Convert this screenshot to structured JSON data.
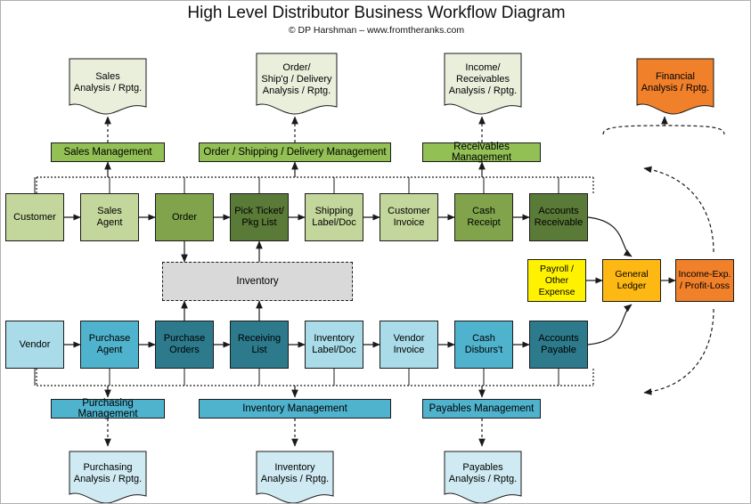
{
  "header": {
    "title": "High Level Distributor Business Workflow Diagram",
    "subtitle": "© DP Harshman – www.fromtheranks.com"
  },
  "colors": {
    "green_light": "#C3D69B",
    "green_mid": "#80A34C",
    "green_dark": "#5A7A37",
    "green_mgmt": "#92C055",
    "blue_light": "#A9DCE8",
    "blue_mid": "#4FB3CE",
    "blue_dark": "#2C7A8C",
    "blue_mgmt": "#4FB3CE",
    "report_green": "#EAEFDC",
    "report_blue": "#CFEAF2",
    "yellow": "#FFF200",
    "amber": "#FDB813",
    "orange": "#F0802A",
    "gray": "#D9D9D9",
    "stroke": "#1A1A1A"
  },
  "top_reports": [
    {
      "label": "Sales\nAnalysis / Rptg.",
      "fill": "report_green"
    },
    {
      "label": "Order/\nShip'g / Delivery\nAnalysis / Rptg.",
      "fill": "report_green"
    },
    {
      "label": "Income/\nReceivables\nAnalysis / Rptg.",
      "fill": "report_green"
    },
    {
      "label": "Financial\nAnalysis / Rptg.",
      "fill": "orange"
    }
  ],
  "top_management": [
    {
      "label": "Sales Management"
    },
    {
      "label": "Order / Shipping / Delivery Management"
    },
    {
      "label": "Receivables Management"
    }
  ],
  "sales_row": [
    {
      "label": "Customer",
      "fill": "green_light"
    },
    {
      "label": "Sales\nAgent",
      "fill": "green_light"
    },
    {
      "label": "Order",
      "fill": "green_mid"
    },
    {
      "label": "Pick Ticket/\nPkg List",
      "fill": "green_dark"
    },
    {
      "label": "Shipping\nLabel/Doc",
      "fill": "green_light"
    },
    {
      "label": "Customer\nInvoice",
      "fill": "green_light"
    },
    {
      "label": "Cash\nReceipt",
      "fill": "green_mid"
    },
    {
      "label": "Accounts\nReceivable",
      "fill": "green_dark"
    }
  ],
  "inventory": {
    "label": "Inventory",
    "fill": "gray"
  },
  "purchase_row": [
    {
      "label": "Vendor",
      "fill": "blue_light"
    },
    {
      "label": "Purchase\nAgent",
      "fill": "blue_mid"
    },
    {
      "label": "Purchase\nOrders",
      "fill": "blue_dark"
    },
    {
      "label": "Receiving\nList",
      "fill": "blue_dark"
    },
    {
      "label": "Inventory\nLabel/Doc",
      "fill": "blue_light"
    },
    {
      "label": "Vendor\nInvoice",
      "fill": "blue_light"
    },
    {
      "label": "Cash\nDisburs't",
      "fill": "blue_mid"
    },
    {
      "label": "Accounts\nPayable",
      "fill": "blue_dark"
    }
  ],
  "bottom_management": [
    {
      "label": "Purchasing Management"
    },
    {
      "label": "Inventory Management"
    },
    {
      "label": "Payables Management"
    }
  ],
  "bottom_reports": [
    {
      "label": "Purchasing\nAnalysis / Rptg.",
      "fill": "report_blue"
    },
    {
      "label": "Inventory\nAnalysis / Rptg.",
      "fill": "report_blue"
    },
    {
      "label": "Payables\nAnalysis / Rptg.",
      "fill": "report_blue"
    }
  ],
  "financial_row": [
    {
      "label": "Payroll /\nOther\nExpense",
      "fill": "yellow"
    },
    {
      "label": "General\nLedger",
      "fill": "amber"
    },
    {
      "label": "Income-Exp.\n/ Profit-Loss",
      "fill": "orange"
    }
  ]
}
